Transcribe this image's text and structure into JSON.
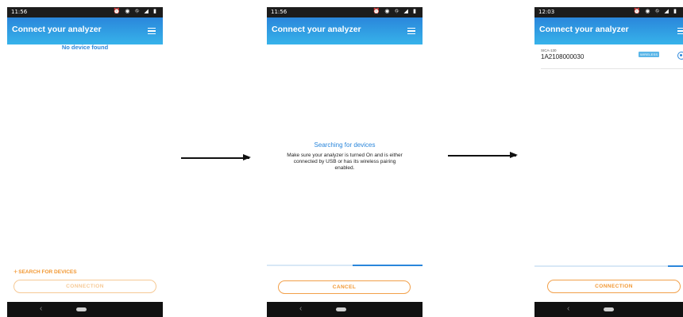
{
  "app": {
    "title": "Connect your analyzer"
  },
  "status_icons": "⏰ ◉ ⛗ ◢ ▮",
  "screens": [
    {
      "time": "11:56",
      "message": "No device found",
      "search_link": "SEARCH FOR DEVICES",
      "button": "CONNECTION"
    },
    {
      "time": "11:56",
      "searching_title": "Searching for devices",
      "searching_body": "Make sure your analyzer is turned On and is either connected by USB or has its wireless pairing enabled.",
      "progress": 0.45,
      "button": "CANCEL"
    },
    {
      "time": "12:03",
      "device": {
        "model": "SICA-130",
        "serial": "1A2108000030",
        "badge": "WIRELESS",
        "selected": true
      },
      "progress": 0.1,
      "button": "CONNECTION"
    }
  ],
  "nav": {
    "back_glyph": "‹"
  },
  "colors": {
    "accent": "#2a86db",
    "button": "#f29833"
  }
}
